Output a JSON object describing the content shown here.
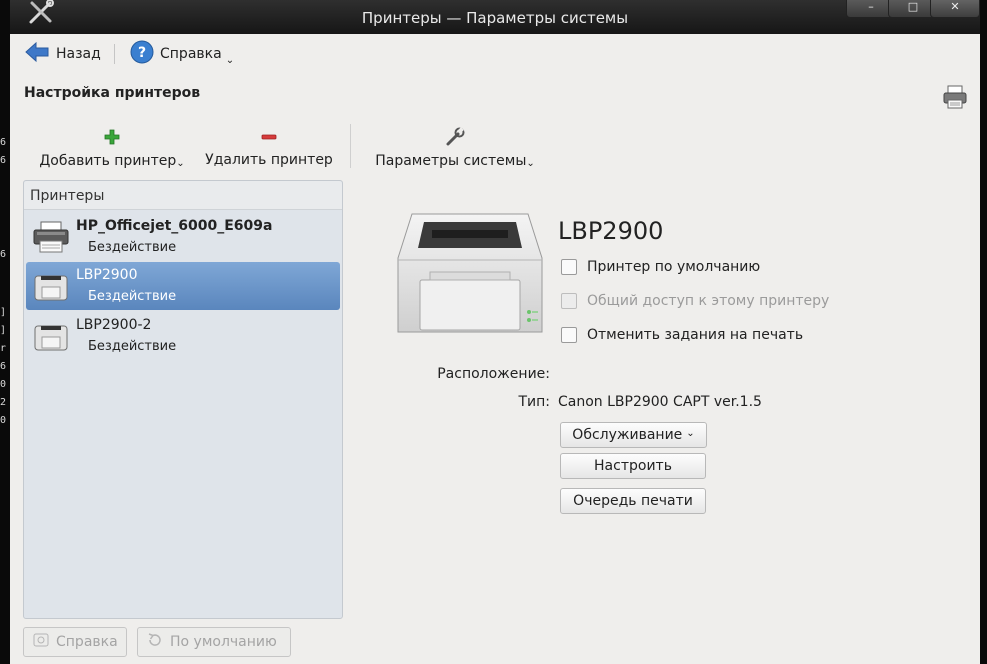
{
  "window": {
    "title": "Принтеры — Параметры системы",
    "controls": [
      "minimize-icon",
      "maximize-icon",
      "close-icon"
    ]
  },
  "background_fragments": [
    "6",
    "6",
    "6",
    "]",
    "]",
    "r",
    "6",
    "0",
    "2",
    "0"
  ],
  "toolbar": {
    "back_label": "Назад",
    "help_label": "Справка"
  },
  "section": {
    "title": "Настройка принтеров"
  },
  "actions": {
    "add_label": "Добавить принтер",
    "remove_label": "Удалить принтер",
    "system_label": "Параметры системы"
  },
  "printer_list": {
    "header": "Принтеры",
    "items": [
      {
        "name": "HP_Officejet_6000_E609a",
        "state": "Бездействие",
        "selected": false,
        "bold": true
      },
      {
        "name": "LBP2900",
        "state": "Бездействие",
        "selected": true,
        "bold": false
      },
      {
        "name": "LBP2900-2",
        "state": "Бездействие",
        "selected": false,
        "bold": false
      }
    ]
  },
  "details": {
    "title": "LBP2900",
    "default_checkbox": "Принтер по умолчанию",
    "share_checkbox": "Общий доступ к этому принтеру",
    "reject_checkbox": "Отменить задания на печать",
    "location_label": "Расположение:",
    "location_value": "",
    "type_label": "Тип:",
    "type_value": "Canon LBP2900 CAPT ver.1.5",
    "maintenance_button": "Обслуживание",
    "configure_button": "Настроить",
    "queue_button": "Очередь печати"
  },
  "bottom": {
    "help_label": "Справка",
    "default_label": "По умолчанию"
  },
  "colors": {
    "selection": "#6b95c9",
    "add": "#3aa63a",
    "remove": "#d63b3b",
    "titlebar": "#1f1f1f"
  }
}
